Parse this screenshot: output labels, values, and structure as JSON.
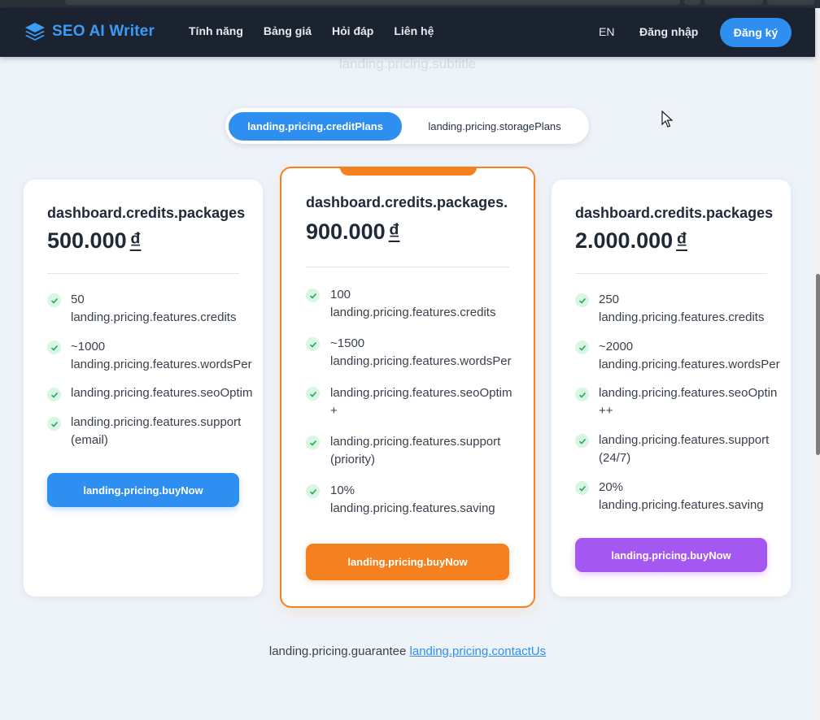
{
  "header": {
    "brand": "SEO AI Writer",
    "nav": [
      "Tính năng",
      "Bảng giá",
      "Hỏi đáp",
      "Liên hệ"
    ],
    "language": "EN",
    "login": "Đăng nhập",
    "signup": "Đăng ký"
  },
  "pricing": {
    "subtitle": "landing.pricing.subtitle",
    "tabs": {
      "credit": "landing.pricing.creditPlans",
      "storage": "landing.pricing.storagePlans"
    },
    "plans": [
      {
        "name": "dashboard.credits.packages",
        "price": "500.000",
        "currency": "₫",
        "features": [
          {
            "l1": "50",
            "l2": "landing.pricing.features.credits"
          },
          {
            "l1": "~1000",
            "l2": "landing.pricing.features.wordsPer"
          },
          {
            "l1": "landing.pricing.features.seoOptim",
            "l2": ""
          },
          {
            "l1": "landing.pricing.features.support",
            "l2": "(email)"
          }
        ],
        "buy": "landing.pricing.buyNow"
      },
      {
        "name": "dashboard.credits.packages.",
        "price": "900.000",
        "currency": "₫",
        "features": [
          {
            "l1": "100",
            "l2": "landing.pricing.features.credits"
          },
          {
            "l1": "~1500",
            "l2": "landing.pricing.features.wordsPer"
          },
          {
            "l1": "landing.pricing.features.seoOptim",
            "l2": "+"
          },
          {
            "l1": "landing.pricing.features.support",
            "l2": "(priority)"
          },
          {
            "l1": "10%",
            "l2": "landing.pricing.features.saving"
          }
        ],
        "buy": "landing.pricing.buyNow"
      },
      {
        "name": "dashboard.credits.packages",
        "price": "2.000.000",
        "currency": "₫",
        "features": [
          {
            "l1": "250",
            "l2": "landing.pricing.features.credits"
          },
          {
            "l1": "~2000",
            "l2": "landing.pricing.features.wordsPer"
          },
          {
            "l1": "landing.pricing.features.seoOptin",
            "l2": "++"
          },
          {
            "l1": "landing.pricing.features.support",
            "l2": "(24/7)"
          },
          {
            "l1": "20%",
            "l2": "landing.pricing.features.saving"
          }
        ],
        "buy": "landing.pricing.buyNow"
      }
    ],
    "guarantee": "landing.pricing.guarantee",
    "contact": "landing.pricing.contactUs"
  },
  "colors": {
    "navbar": "#1b2331",
    "accent_blue": "#2e8ff0",
    "accent_orange": "#f58020",
    "accent_purple": "#a557f2",
    "check_bg": "#d9f5e3",
    "check_fg": "#22a85a"
  }
}
